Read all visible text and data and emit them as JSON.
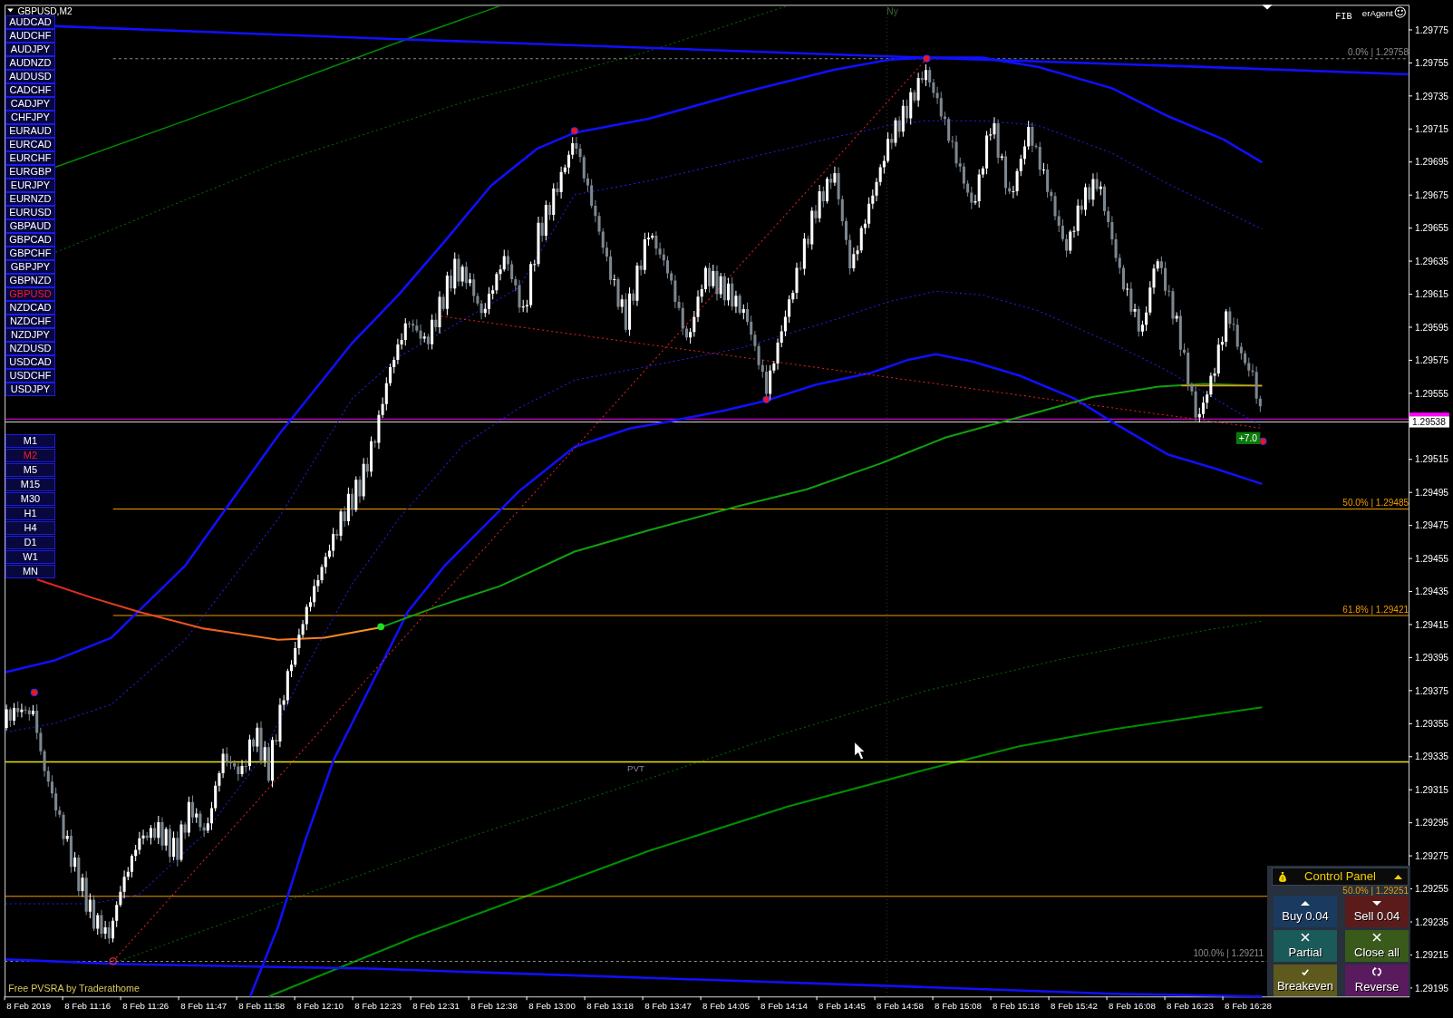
{
  "chart": {
    "title": "GBPUSD,M2",
    "indicator_label": "FIB",
    "expert_label": "erAgent",
    "session_label": "Ny",
    "pivot_label": "PVT",
    "footer": "Free PVSRA by Traderathome",
    "profit_label": "+7.0",
    "fib_levels": [
      {
        "label": "0.0% | 1.29758",
        "kind": "dashed"
      },
      {
        "label": "50.0% | 1.29485",
        "kind": "solid"
      },
      {
        "label": "61.8% | 1.29421",
        "kind": "solid"
      },
      {
        "label": "50.0% | 1.29251",
        "kind": "solid"
      },
      {
        "label": "100.0% | 1.29211",
        "kind": "dashed"
      }
    ]
  },
  "symbols": [
    {
      "label": "AUDCAD",
      "selected": false
    },
    {
      "label": "AUDCHF",
      "selected": false
    },
    {
      "label": "AUDJPY",
      "selected": false
    },
    {
      "label": "AUDNZD",
      "selected": false
    },
    {
      "label": "AUDUSD",
      "selected": false
    },
    {
      "label": "CADCHF",
      "selected": false
    },
    {
      "label": "CADJPY",
      "selected": false
    },
    {
      "label": "CHFJPY",
      "selected": false
    },
    {
      "label": "EURAUD",
      "selected": false
    },
    {
      "label": "EURCAD",
      "selected": false
    },
    {
      "label": "EURCHF",
      "selected": false
    },
    {
      "label": "EURGBP",
      "selected": false
    },
    {
      "label": "EURJPY",
      "selected": false
    },
    {
      "label": "EURNZD",
      "selected": false
    },
    {
      "label": "EURUSD",
      "selected": false
    },
    {
      "label": "GBPAUD",
      "selected": false
    },
    {
      "label": "GBPCAD",
      "selected": false
    },
    {
      "label": "GBPCHF",
      "selected": false
    },
    {
      "label": "GBPJPY",
      "selected": false
    },
    {
      "label": "GBPNZD",
      "selected": false
    },
    {
      "label": "GBPUSD",
      "selected": true
    },
    {
      "label": "NZDCAD",
      "selected": false
    },
    {
      "label": "NZDCHF",
      "selected": false
    },
    {
      "label": "NZDJPY",
      "selected": false
    },
    {
      "label": "NZDUSD",
      "selected": false
    },
    {
      "label": "USDCAD",
      "selected": false
    },
    {
      "label": "USDCHF",
      "selected": false
    },
    {
      "label": "USDJPY",
      "selected": false
    }
  ],
  "timeframes": [
    {
      "label": "M1",
      "selected": false
    },
    {
      "label": "M2",
      "selected": true
    },
    {
      "label": "M5",
      "selected": false
    },
    {
      "label": "M15",
      "selected": false
    },
    {
      "label": "M30",
      "selected": false
    },
    {
      "label": "H1",
      "selected": false
    },
    {
      "label": "H4",
      "selected": false
    },
    {
      "label": "D1",
      "selected": false
    },
    {
      "label": "W1",
      "selected": false
    },
    {
      "label": "MN",
      "selected": false
    }
  ],
  "price_axis": {
    "labels": [
      "1.29775",
      "1.29755",
      "1.29735",
      "1.29715",
      "1.29695",
      "1.29675",
      "1.29655",
      "1.29635",
      "1.29615",
      "1.29595",
      "1.29575",
      "1.29555",
      "1.29515",
      "1.29495",
      "1.29475",
      "1.29455",
      "1.29435",
      "1.29415",
      "1.29395",
      "1.29375",
      "1.29355",
      "1.29335",
      "1.29315",
      "1.29295",
      "1.29275",
      "1.29255",
      "1.29235",
      "1.29215",
      "1.29195"
    ],
    "bid_label": "1.29538"
  },
  "time_axis": {
    "labels": [
      "8 Feb 2019",
      "8 Feb 11:16",
      "8 Feb 11:26",
      "8 Feb 11:47",
      "8 Feb 11:58",
      "8 Feb 12:10",
      "8 Feb 12:23",
      "8 Feb 12:31",
      "8 Feb 12:38",
      "8 Feb 13:00",
      "8 Feb 13:18",
      "8 Feb 13:47",
      "8 Feb 14:05",
      "8 Feb 14:14",
      "8 Feb 14:45",
      "8 Feb 14:58",
      "8 Feb 15:08",
      "8 Feb 15:18",
      "8 Feb 15:42",
      "8 Feb 16:08",
      "8 Feb 16:23",
      "8 Feb 16:28"
    ]
  },
  "control_panel": {
    "title": "Control Panel",
    "expanded": true,
    "buttons": [
      {
        "label": "Buy 0.04",
        "kind": "buy"
      },
      {
        "label": "Sell 0.04",
        "kind": "sell"
      },
      {
        "label": "Partial",
        "kind": "partial"
      },
      {
        "label": "Close all",
        "kind": "close"
      },
      {
        "label": "Breakeven",
        "kind": "breakeven"
      },
      {
        "label": "Reverse",
        "kind": "reverse"
      }
    ]
  }
}
